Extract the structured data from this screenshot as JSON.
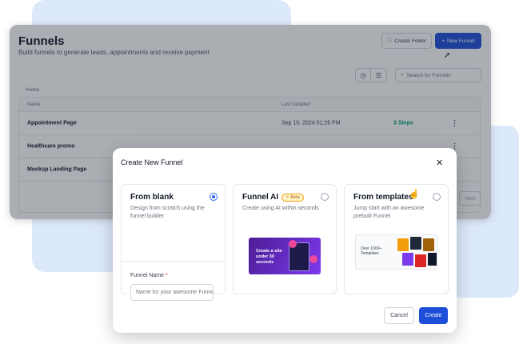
{
  "colors": {
    "accent": "#1d4ed8",
    "steps": "#059669",
    "backdrop": "#dce9fb"
  },
  "page": {
    "title": "Funnels",
    "subtitle": "Build funnels to generate leads, appointments and receive payment",
    "create_folder_label": "Create Folder",
    "new_funnel_label": "New Funnel",
    "search_placeholder": "Search for Funnels",
    "breadcrumb": "Home",
    "next_label": "Next"
  },
  "table": {
    "headers": {
      "name": "Name",
      "last_updated": "Last Updated"
    },
    "rows": [
      {
        "name": "Appointment Page",
        "date": "Sep 10, 2024 01:26 PM",
        "steps": "3 Steps"
      },
      {
        "name": "Healthcare promo",
        "date": "",
        "steps": ""
      },
      {
        "name": "Mockup Landing Page",
        "date": "",
        "steps": ""
      }
    ]
  },
  "modal": {
    "title": "Create New Funnel",
    "close_icon": "close-icon",
    "options": [
      {
        "title": "From blank",
        "desc": "Design from scratch using the funnel builder",
        "selected": true
      },
      {
        "title": "Funnel AI",
        "badge": "Beta",
        "desc": "Create using AI within seconds",
        "selected": false
      },
      {
        "title": "From templates",
        "desc": "Jump start with an awesome prebuilt Funnel",
        "selected": false
      }
    ],
    "field_label": "Funnel Name",
    "field_required": "*",
    "field_placeholder": "Name for your awesome Funnel",
    "ai_image_text": "Create a site under 30 seconds",
    "template_image_text": "Over 1000+ Templates",
    "cancel_label": "Cancel",
    "create_label": "Create"
  }
}
